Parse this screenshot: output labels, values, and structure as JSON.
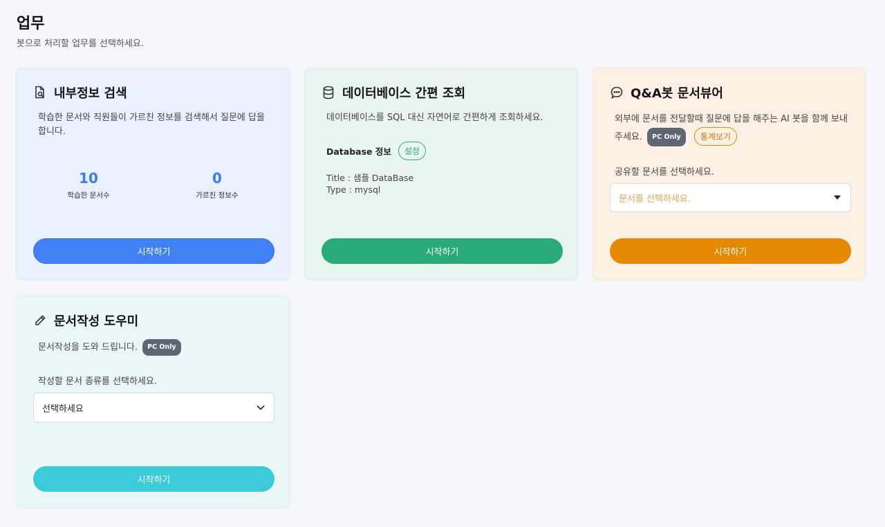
{
  "header": {
    "title": "업무",
    "subtitle": "봇으로 처리할 업무를 선택하세요."
  },
  "cards": {
    "search": {
      "icon": "document-search-icon",
      "title": "내부정보 검색",
      "description": "학습한 문서와 직원들이 가르친 정보를 검색해서 질문에 답을 합니다.",
      "stats": [
        {
          "value": "10",
          "label": "학습한 문서수"
        },
        {
          "value": "0",
          "label": "가르친 정보수"
        }
      ],
      "button_label": "시작하기"
    },
    "database": {
      "icon": "database-icon",
      "title": "데이터베이스 간편 조회",
      "description": "데이터베이스를 SQL 대신 자연어로 간편하게 조회하세요.",
      "info_label": "Database 정보",
      "settings_label": "설정",
      "title_line": "Title : 샘플 DataBase",
      "type_line": "Type : mysql",
      "button_label": "시작하기"
    },
    "qa_viewer": {
      "icon": "chat-bubble-icon",
      "title": "Q&A봇 문서뷰어",
      "description": "외부에 문서를 전달할때 질문에 답을 해주는 AI 봇을 함께 보내주세요.",
      "pc_badge": "PC Only",
      "stats_button": "통계보기",
      "select_label": "공유할 문서를 선택하세요.",
      "select_placeholder": "문서를 선택하세요.",
      "button_label": "시작하기"
    },
    "writer": {
      "icon": "pencil-icon",
      "title": "문서작성 도우미",
      "description": "문서작성을 도와 드립니다.",
      "pc_badge": "PC Only",
      "select_label": "작성할 문서 종류를 선택하세요.",
      "select_value": "선택하세요",
      "button_label": "시작하기"
    }
  },
  "colors": {
    "blue": "#4180f7",
    "green": "#2aa97b",
    "orange": "#e58a00",
    "cyan": "#3ccad8"
  }
}
